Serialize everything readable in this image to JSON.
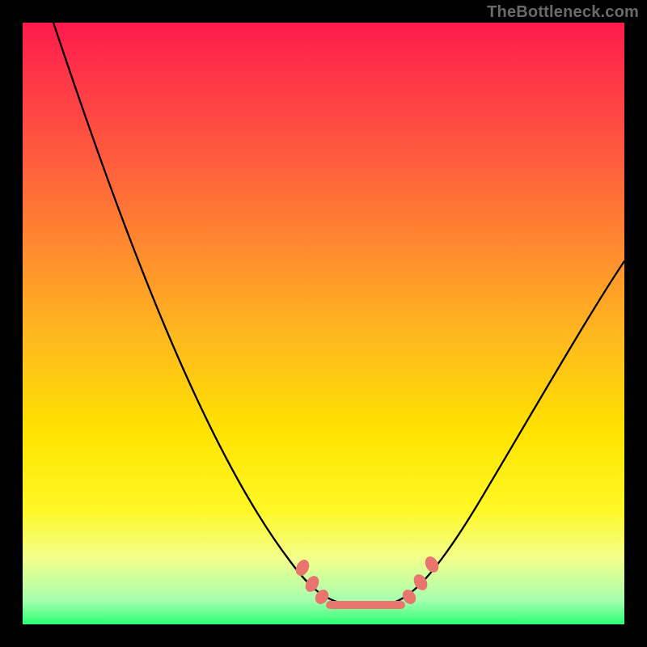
{
  "watermark": "TheBottleneck.com",
  "colors": {
    "frame_bg_top": "#ff1a4d",
    "frame_bg_bottom": "#2bff73",
    "watermark": "#6a6a6a",
    "curve": "#000000",
    "marker": "#e8766e",
    "frame_border": "#000000"
  },
  "chart_data": {
    "type": "line",
    "title": "",
    "xlabel": "",
    "ylabel": "",
    "xlim": [
      0,
      100
    ],
    "ylim": [
      0,
      100
    ],
    "grid": false,
    "legend": false,
    "series": [
      {
        "name": "bottleneck-curve",
        "x": [
          5,
          10,
          15,
          20,
          25,
          30,
          35,
          40,
          45,
          48,
          50,
          52,
          55,
          58,
          60,
          63,
          67,
          72,
          78,
          85,
          92,
          100
        ],
        "y": [
          100,
          89,
          77,
          66,
          55,
          44,
          33,
          23,
          13,
          7,
          4,
          2,
          1,
          1,
          1,
          2,
          5,
          11,
          20,
          31,
          43,
          57
        ]
      }
    ],
    "annotations": {
      "flat_band": {
        "x_start": 52,
        "x_end": 63,
        "y": 1
      },
      "left_ticks": [
        {
          "x": 47,
          "y": 10
        },
        {
          "x": 49,
          "y": 6
        },
        {
          "x": 50,
          "y": 4
        }
      ],
      "right_ticks": [
        {
          "x": 64,
          "y": 4
        },
        {
          "x": 66,
          "y": 6
        },
        {
          "x": 68,
          "y": 9
        }
      ]
    }
  }
}
